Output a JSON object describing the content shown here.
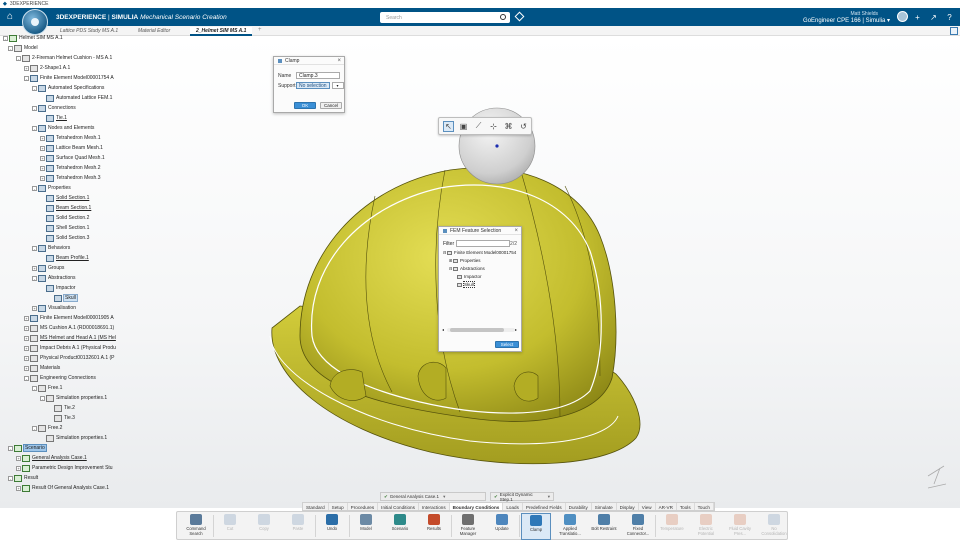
{
  "app": {
    "window_title": "3DEXPERIENCE",
    "brand_prefix": "3DEXPERIENCE",
    "brand_sep": " | ",
    "brand_product": "SIMULIA",
    "brand_app": " Mechanical Scenario Creation",
    "search_placeholder": "Search",
    "user_name": "Matt Shields",
    "platform": "GoEngineer CPE 166 | Simulia ▾",
    "accent": "#005386"
  },
  "tabs": [
    {
      "label": "Lattice PDS Study MS A.1"
    },
    {
      "label": "Material Editor"
    },
    {
      "label": "2_Helmet SIM MS A.1"
    }
  ],
  "tab_add": "+",
  "tree": [
    {
      "label": "Helmet SIM MS A.1",
      "icon": "sim",
      "exp": "-"
    },
    {
      "label": "Model",
      "icon": "prod",
      "exp": "-"
    },
    {
      "label": "2-Fireman Helmet Cushion - MS A.1",
      "icon": "prod",
      "exp": "-"
    },
    {
      "label": "2-Shape1 A.1",
      "icon": "prod",
      "exp": "+"
    },
    {
      "label": "Finite Element Model00001754 A",
      "icon": "fem",
      "exp": "-"
    },
    {
      "label": "Automated Specifications",
      "icon": "fem",
      "exp": "-"
    },
    {
      "label": "Automated Lattice FEM.1",
      "icon": "fem",
      "exp": ""
    },
    {
      "label": "Connections",
      "icon": "fem",
      "exp": "-"
    },
    {
      "label": "Tie.1",
      "icon": "fem",
      "exp": "",
      "style": "ul"
    },
    {
      "label": "Nodes and Elements",
      "icon": "fem",
      "exp": "-"
    },
    {
      "label": "Tetrahedron Mesh.1",
      "icon": "fem",
      "exp": "+"
    },
    {
      "label": "Lattice Beam Mesh.1",
      "icon": "fem",
      "exp": "+"
    },
    {
      "label": "Surface Quad Mesh.1",
      "icon": "fem",
      "exp": "+"
    },
    {
      "label": "Tetrahedron Mesh.2",
      "icon": "fem",
      "exp": "+"
    },
    {
      "label": "Tetrahedron Mesh.3",
      "icon": "fem",
      "exp": "+"
    },
    {
      "label": "Properties",
      "icon": "fem",
      "exp": "-"
    },
    {
      "label": "Solid Section.1",
      "icon": "fem",
      "exp": "",
      "style": "ul"
    },
    {
      "label": "Beam Section.1",
      "icon": "fem",
      "exp": "",
      "style": "ul"
    },
    {
      "label": "Solid Section.2",
      "icon": "fem",
      "exp": ""
    },
    {
      "label": "Shell Section.1",
      "icon": "fem",
      "exp": ""
    },
    {
      "label": "Solid Section.3",
      "icon": "fem",
      "exp": ""
    },
    {
      "label": "Behaviors",
      "icon": "fem",
      "exp": "-"
    },
    {
      "label": "Beam Profile.1",
      "icon": "fem",
      "exp": "",
      "style": "ul"
    },
    {
      "label": "Groups",
      "icon": "fem",
      "exp": "+"
    },
    {
      "label": "Abstractions",
      "icon": "fem",
      "exp": "-"
    },
    {
      "label": "Impactor",
      "icon": "fem",
      "exp": ""
    },
    {
      "label": "Skull",
      "icon": "fem",
      "exp": "",
      "style": "hl"
    },
    {
      "label": "Visualisation",
      "icon": "fem",
      "exp": "+"
    },
    {
      "label": "Finite Element Model00001905 A",
      "icon": "fem",
      "exp": "+"
    },
    {
      "label": "MS Cushion A.1 (RD00018691.1)",
      "icon": "prod",
      "exp": "+"
    },
    {
      "label": "MS Helmet and Head A.1 (MS Hel",
      "icon": "prod",
      "exp": "+",
      "style": "ul"
    },
    {
      "label": "Impact Debris A.1 (Physical Produ",
      "icon": "prod",
      "exp": "+"
    },
    {
      "label": "Physical Product00132601 A.1 (P",
      "icon": "prod",
      "exp": "+"
    },
    {
      "label": "Materials",
      "icon": "prod",
      "exp": "+"
    },
    {
      "label": "Engineering Connections",
      "icon": "prod",
      "exp": "-"
    },
    {
      "label": "Free.1",
      "icon": "prod",
      "exp": "-"
    },
    {
      "label": "Simulation properties.1",
      "icon": "prod",
      "exp": "-"
    },
    {
      "label": "Tie.2",
      "icon": "prod",
      "exp": ""
    },
    {
      "label": "Tie.3",
      "icon": "prod",
      "exp": ""
    },
    {
      "label": "Free.2",
      "icon": "prod",
      "exp": "-"
    },
    {
      "label": "Simulation properties.1",
      "icon": "prod",
      "exp": ""
    },
    {
      "label": "Scenario",
      "icon": "sim",
      "exp": "-",
      "style": "sel"
    },
    {
      "label": "General Analysis Case.1",
      "icon": "sim",
      "exp": "+",
      "style": "ul"
    },
    {
      "label": "Parametric Design Improvement Stu",
      "icon": "sim",
      "exp": "+"
    },
    {
      "label": "Result",
      "icon": "sim",
      "exp": "-"
    },
    {
      "label": "Result Of General Analysis Case.1",
      "icon": "sim",
      "exp": "+"
    }
  ],
  "clamp_dialog": {
    "title": "Clamp",
    "name_label": "Name",
    "name_value": "Clamp.3",
    "support_label": "Support",
    "support_value": "No selection",
    "ok": "OK",
    "cancel": "Cancel"
  },
  "fem_dialog": {
    "title": "FEM Feature Selection",
    "filter_label": "Filter",
    "count": "2/2",
    "select": "Select",
    "nodes": [
      {
        "label": "Finite Element Model00001754"
      },
      {
        "label": "Properties"
      },
      {
        "label": "Abstractions"
      },
      {
        "label": "Impactor"
      },
      {
        "label": "Skull"
      }
    ]
  },
  "context_bar": {
    "case": "General Analysis Case.1",
    "step": "Explicit Dynamic Step.1"
  },
  "section_tabs": [
    "Standard",
    "Setup",
    "Procedures",
    "Initial Conditions",
    "Interactions",
    "Boundary Conditions",
    "Loads",
    "Predefined Fields",
    "Durability",
    "Simulate",
    "Display",
    "View",
    "AR-VR",
    "Tools",
    "Touch"
  ],
  "section_tab_active": "Boundary Conditions",
  "actions": [
    {
      "label": "Command Search",
      "icon": "search-icon",
      "color": "#5a7a9a",
      "dim": false
    },
    {
      "label": "Cut",
      "icon": "cut-icon",
      "color": "#8aa4bf",
      "dim": true
    },
    {
      "label": "Copy",
      "icon": "copy-icon",
      "color": "#8aa4bf",
      "dim": true
    },
    {
      "label": "Paste",
      "icon": "paste-icon",
      "color": "#8aa4bf",
      "dim": true
    },
    {
      "label": "Undo",
      "icon": "undo-icon",
      "color": "#2b6ea8",
      "dim": false
    },
    {
      "label": "Model",
      "icon": "model-icon",
      "color": "#6c8aa5",
      "dim": false
    },
    {
      "label": "Scenario",
      "icon": "scenario-icon",
      "color": "#2d8a8a",
      "dim": false
    },
    {
      "label": "Results",
      "icon": "results-icon",
      "color": "#c44b2b",
      "dim": false
    },
    {
      "label": "Feature Manager",
      "icon": "feature-manager-icon",
      "color": "#6f6f6f",
      "dim": false
    },
    {
      "label": "Update",
      "icon": "update-icon",
      "color": "#4d86bd",
      "dim": false
    },
    {
      "label": "Clamp",
      "icon": "clamp-icon",
      "color": "#2e78b8",
      "dim": false
    },
    {
      "label": "Applied Translatio...",
      "icon": "applied-translation-icon",
      "color": "#4f8fc2",
      "dim": false
    },
    {
      "label": "Bolt Restraint",
      "icon": "bolt-restraint-icon",
      "color": "#4f7fa8",
      "dim": false
    },
    {
      "label": "Fixed Connector...",
      "icon": "fixed-connector-icon",
      "color": "#4f7fa8",
      "dim": false
    },
    {
      "label": "Temperature",
      "icon": "temperature-icon",
      "color": "#d48a6a",
      "dim": true
    },
    {
      "label": "Electric Potential",
      "icon": "electric-potential-icon",
      "color": "#d48a6a",
      "dim": true
    },
    {
      "label": "Fluid Cavity Pres...",
      "icon": "fluid-cavity-icon",
      "color": "#d48a6a",
      "dim": true
    },
    {
      "label": "No Consolidation",
      "icon": "no-consolidation-icon",
      "color": "#8aa4bf",
      "dim": true
    }
  ],
  "active_action": "Clamp",
  "colors": {
    "helmet": "#c8c232",
    "helmet_dark": "#7f7a12",
    "impactor": "#d3d3d3",
    "selection": "#9ec6ea"
  }
}
